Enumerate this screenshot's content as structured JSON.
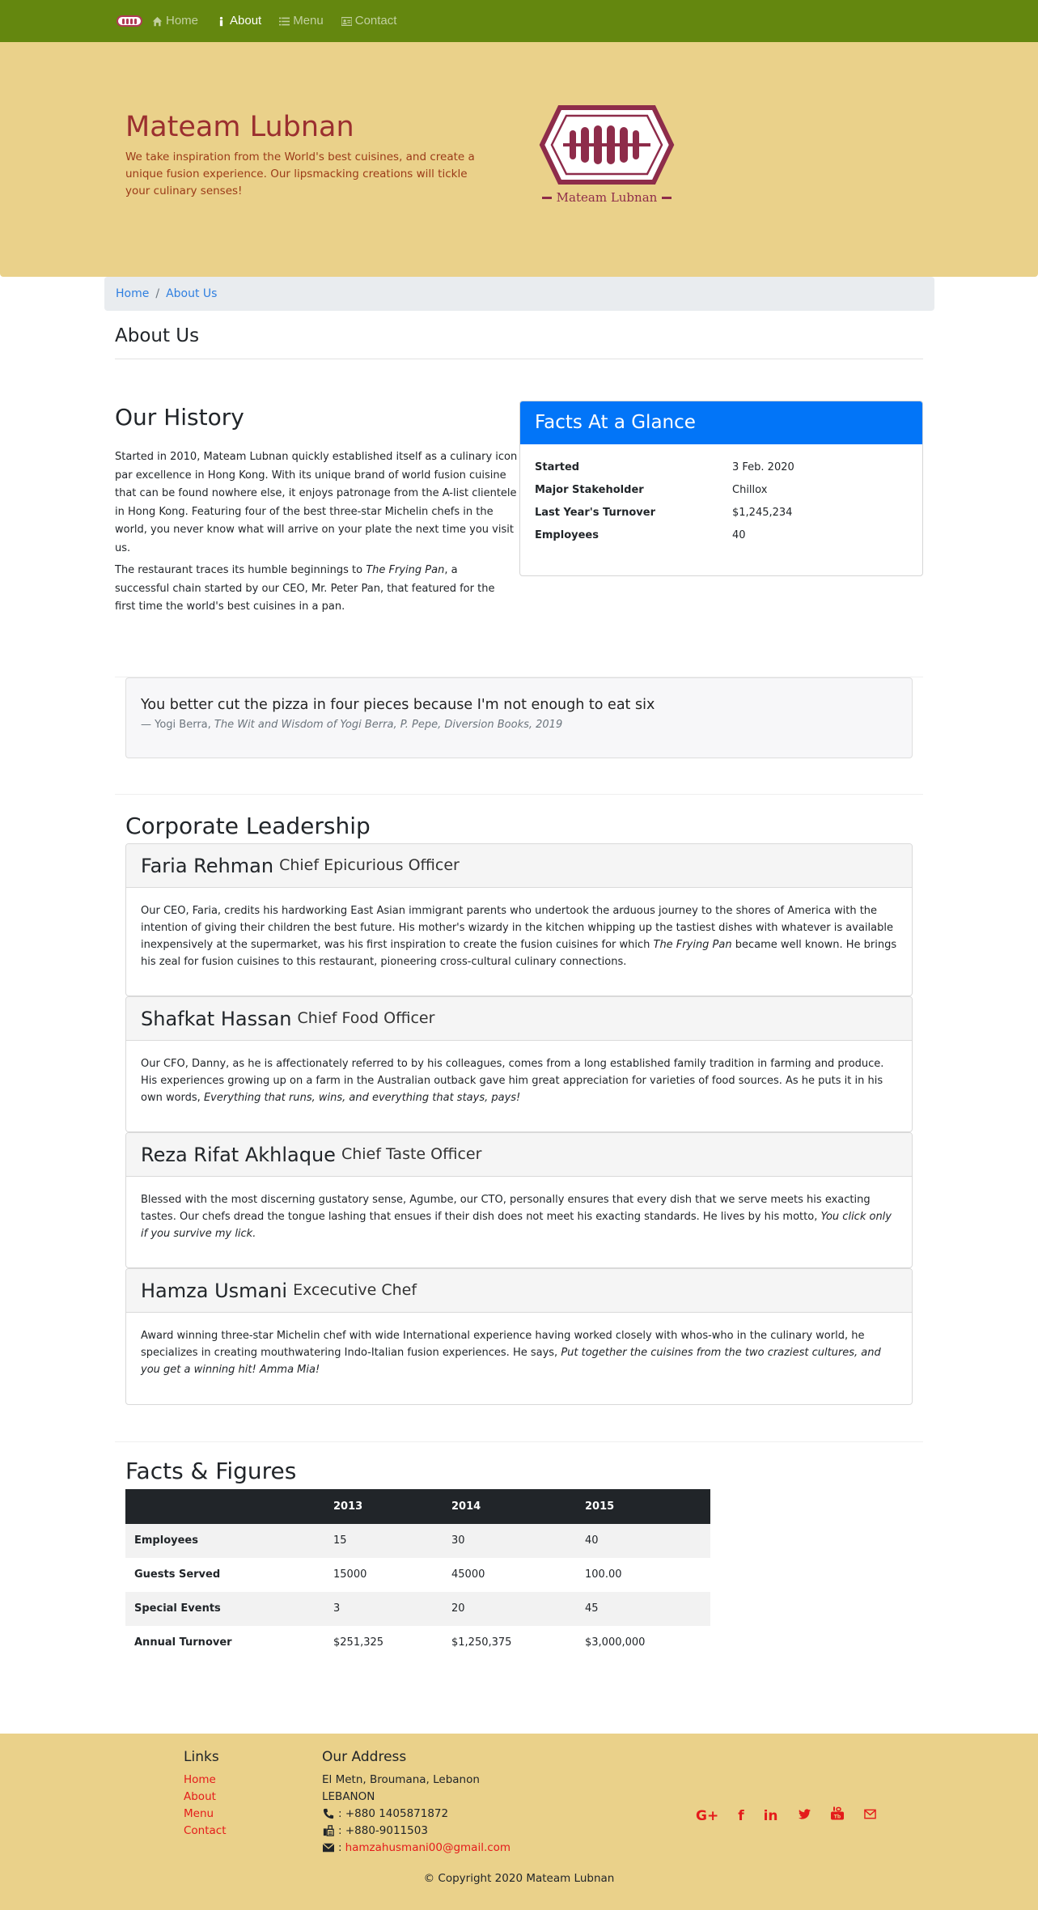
{
  "nav": {
    "items": [
      {
        "label": "Home",
        "icon": "home-icon",
        "active": false
      },
      {
        "label": "About",
        "icon": "info-icon",
        "active": true
      },
      {
        "label": "Menu",
        "icon": "list-icon",
        "active": false
      },
      {
        "label": "Contact",
        "icon": "address-card-icon",
        "active": false
      }
    ]
  },
  "jumbotron": {
    "title": "Mateam Lubnan",
    "tagline": "We take inspiration from the World's best cuisines, and create a unique fusion experience. Our lipsmacking creations will tickle your culinary senses!",
    "logo_text": "Mateam Lubnan"
  },
  "breadcrumb": {
    "home": "Home",
    "sep": "/",
    "current": "About Us"
  },
  "page_title": "About Us",
  "history": {
    "title": "Our History",
    "p1": "Started in 2010, Mateam Lubnan quickly established itself as a culinary icon par excellence in Hong Kong. With its unique brand of world fusion cuisine that can be found nowhere else, it enjoys patronage from the A-list clientele in Hong Kong. Featuring four of the best three-star Michelin chefs in the world, you never know what will arrive on your plate the next time you visit us.",
    "p2_a": "The restaurant traces its humble beginnings to ",
    "p2_em": "The Frying Pan",
    "p2_b": ", a successful chain started by our CEO, Mr. Peter Pan, that featured for the first time the world's best cuisines in a pan."
  },
  "facts": {
    "title": "Facts At a Glance",
    "rows": [
      {
        "k": "Started",
        "v": "3 Feb. 2020"
      },
      {
        "k": "Major Stakeholder",
        "v": "Chillox"
      },
      {
        "k": "Last Year's Turnover",
        "v": "$1,245,234"
      },
      {
        "k": "Employees",
        "v": "40"
      }
    ]
  },
  "quote": {
    "text": "You better cut the pizza in four pieces because I'm not enough to eat six",
    "author": "— Yogi Berra, ",
    "source": "The Wit and Wisdom of Yogi Berra, P. Pepe, Diversion Books, 2019"
  },
  "leadership": {
    "title": "Corporate Leadership",
    "leaders": [
      {
        "name": "Faria Rehman",
        "title": "Chief Epicurious Officer",
        "body_a": "Our CEO, Faria, credits his hardworking East Asian immigrant parents who undertook the arduous journey to the shores of America with the intention of giving their children the best future. His mother's wizardy in the kitchen whipping up the tastiest dishes with whatever is available inexpensively at the supermarket, was his first inspiration to create the fusion cuisines for which ",
        "body_em": "The Frying Pan",
        "body_b": " became well known. He brings his zeal for fusion cuisines to this restaurant, pioneering cross-cultural culinary connections."
      },
      {
        "name": "Shafkat Hassan",
        "title": "Chief Food Officer",
        "body_a": "Our CFO, Danny, as he is affectionately referred to by his colleagues, comes from a long established family tradition in farming and produce. His experiences growing up on a farm in the Australian outback gave him great appreciation for varieties of food sources. As he puts it in his own words, ",
        "body_em": "Everything that runs, wins, and everything that stays, pays!",
        "body_b": ""
      },
      {
        "name": "Reza Rifat Akhlaque",
        "title": "Chief Taste Officer",
        "body_a": "Blessed with the most discerning gustatory sense, Agumbe, our CTO, personally ensures that every dish that we serve meets his exacting tastes. Our chefs dread the tongue lashing that ensues if their dish does not meet his exacting standards. He lives by his motto, ",
        "body_em": "You click only if you survive my lick.",
        "body_b": ""
      },
      {
        "name": "Hamza Usmani",
        "title": "Excecutive Chef",
        "body_a": "Award winning three-star Michelin chef with wide International experience having worked closely with whos-who in the culinary world, he specializes in creating mouthwatering Indo-Italian fusion experiences. He says, ",
        "body_em": "Put together the cuisines from the two craziest cultures, and you get a winning hit! Amma Mia!",
        "body_b": ""
      }
    ]
  },
  "figures": {
    "title": "Facts & Figures",
    "columns": [
      "",
      "2013",
      "2014",
      "2015"
    ],
    "rows": [
      {
        "label": "Employees",
        "values": [
          "15",
          "30",
          "40"
        ]
      },
      {
        "label": "Guests Served",
        "values": [
          "15000",
          "45000",
          "100.00"
        ]
      },
      {
        "label": "Special Events",
        "values": [
          "3",
          "20",
          "45"
        ]
      },
      {
        "label": "Annual Turnover",
        "values": [
          "$251,325",
          "$1,250,375",
          "$3,000,000"
        ]
      }
    ]
  },
  "footer": {
    "links_title": "Links",
    "links": [
      "Home",
      "About",
      "Menu",
      "Contact"
    ],
    "address_title": "Our Address",
    "address_line1": "El Metn, Broumana, Lebanon",
    "address_line2": "LEBANON",
    "phone": ": +880 1405871872",
    "fax": ": +880-9011503",
    "email_prefix": ": ",
    "email": "hamzahusmani00@gmail.com",
    "social": [
      {
        "icon": "google-plus-icon",
        "glyph": "G+"
      },
      {
        "icon": "facebook-icon",
        "glyph": "f"
      },
      {
        "icon": "linkedin-icon",
        "glyph": "in"
      },
      {
        "icon": "twitter-icon",
        "glyph": "🐦"
      },
      {
        "icon": "youtube-icon",
        "glyph": "▶"
      },
      {
        "icon": "mail-icon",
        "glyph": "✉"
      }
    ],
    "copyright": "© Copyright 2020 Mateam Lubnan"
  },
  "colors": {
    "navbar": "#64870f",
    "jumbotron": "#ead18a",
    "brand_red": "#9b2f2f",
    "card_header": "#0275f8",
    "link_red": "#e41b1b",
    "link_blue": "#2f7fe0"
  }
}
